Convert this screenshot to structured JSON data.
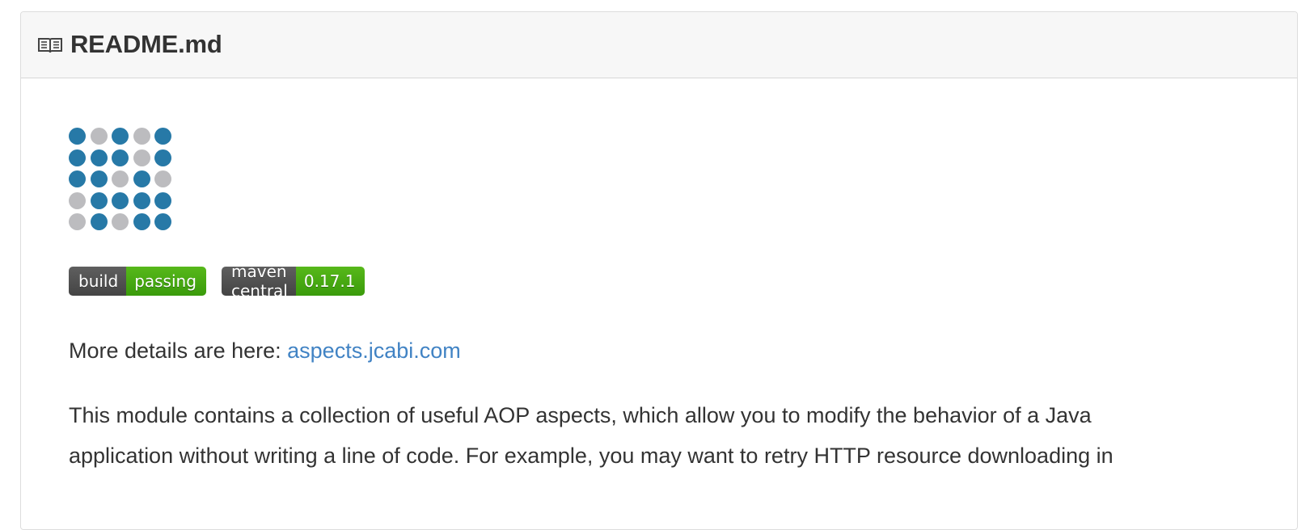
{
  "header": {
    "icon": "book-icon",
    "title": "README.md"
  },
  "logo": {
    "colors": {
      "blue": "#2779a7",
      "gray": "#bcbcbf"
    },
    "grid": [
      [
        "blue",
        "gray",
        "blue",
        "gray",
        "blue"
      ],
      [
        "blue",
        "blue",
        "blue",
        "gray",
        "blue"
      ],
      [
        "blue",
        "blue",
        "gray",
        "blue",
        "gray"
      ],
      [
        "gray",
        "blue",
        "blue",
        "blue",
        "blue"
      ],
      [
        "gray",
        "blue",
        "gray",
        "blue",
        "blue"
      ]
    ]
  },
  "badges": [
    {
      "left": "build",
      "right": "passing",
      "right_color": "#4c1"
    },
    {
      "left": "maven central",
      "right": "0.17.1",
      "right_color": "#4c1"
    }
  ],
  "content": {
    "details_prefix": "More details are here: ",
    "details_link": "aspects.jcabi.com",
    "description_line1": "This module contains a collection of useful AOP aspects, which allow you to modify the behavior of a Java",
    "description_line2": "application without writing a line of code. For example, you may want to retry HTTP resource downloading in"
  }
}
